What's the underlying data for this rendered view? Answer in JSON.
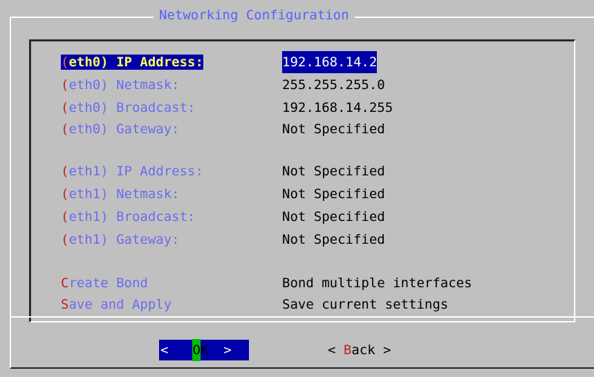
{
  "dialog": {
    "title": "Networking Configuration"
  },
  "menu": {
    "items": [
      {
        "prefix": "(",
        "rest": "eth0) IP Address:",
        "value": "192.168.14.2",
        "selected": true
      },
      {
        "prefix": "(",
        "rest": "eth0) Netmask:",
        "value": "255.255.255.0"
      },
      {
        "prefix": "(",
        "rest": "eth0) Broadcast:",
        "value": "192.168.14.255"
      },
      {
        "prefix": "(",
        "rest": "eth0) Gateway:",
        "value": "Not Specified"
      },
      {
        "prefix": "(",
        "rest": "eth1) IP Address:",
        "value": "Not Specified"
      },
      {
        "prefix": "(",
        "rest": "eth1) Netmask:",
        "value": "Not Specified"
      },
      {
        "prefix": "(",
        "rest": "eth1) Broadcast:",
        "value": "Not Specified"
      },
      {
        "prefix": "(",
        "rest": "eth1) Gateway:",
        "value": "Not Specified"
      },
      {
        "prefix": "C",
        "rest": "reate Bond",
        "value": "Bond multiple interfaces"
      },
      {
        "prefix": "S",
        "rest": "ave and Apply",
        "value": "Save current settings"
      }
    ]
  },
  "buttons": {
    "ok": {
      "left": "<",
      "hotkey": "O",
      "rest": "K",
      "right": ">"
    },
    "back": {
      "left": "< ",
      "hotkey": "B",
      "rest": "ack",
      "right": " >"
    }
  },
  "colors": {
    "background": "#c0c0c0",
    "title": "#5560ff",
    "hotkey": "#c02020",
    "label": "#6b6bf0",
    "selection": "#0000a8",
    "ok_hotkey_bg": "#00c000"
  }
}
